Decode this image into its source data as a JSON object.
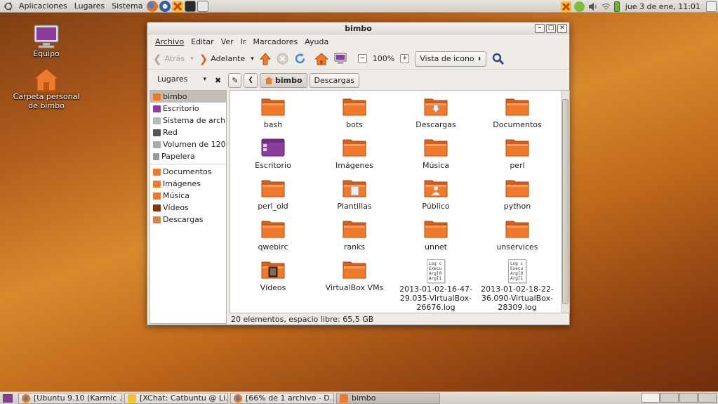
{
  "top_panel": {
    "menus": [
      "Aplicaciones",
      "Lugares",
      "Sistema"
    ],
    "clock": "jue  3 de ene, 11:01"
  },
  "desktop": {
    "icons": [
      {
        "label": "Equipo"
      },
      {
        "label": "Carpeta personal de bimbo"
      }
    ]
  },
  "window": {
    "title": "bimbo",
    "menu": [
      "Archivo",
      "Editar",
      "Ver",
      "Ir",
      "Marcadores",
      "Ayuda"
    ],
    "toolbar": {
      "back": "Atrás",
      "forward": "Adelante",
      "zoom": "100%",
      "view": "Vista de icono"
    },
    "places_label": "Lugares",
    "breadcrumbs": [
      "bimbo",
      "Descargas"
    ],
    "sidebar": {
      "places": [
        "bimbo",
        "Escritorio",
        "Sistema de arch...",
        "Red",
        "Volumen de 120...",
        "Papelera"
      ],
      "bookmarks": [
        "Documentos",
        "Imágenes",
        "Música",
        "Vídeos",
        "Descargas"
      ]
    },
    "files": [
      {
        "name": "bash",
        "kind": "folder"
      },
      {
        "name": "bots",
        "kind": "folder"
      },
      {
        "name": "Descargas",
        "kind": "downloads-folder"
      },
      {
        "name": "Documentos",
        "kind": "folder"
      },
      {
        "name": "Escritorio",
        "kind": "desktop-folder"
      },
      {
        "name": "Imágenes",
        "kind": "folder"
      },
      {
        "name": "Música",
        "kind": "folder"
      },
      {
        "name": "perl",
        "kind": "folder"
      },
      {
        "name": "perl_old",
        "kind": "folder"
      },
      {
        "name": "Plantillas",
        "kind": "templates-folder"
      },
      {
        "name": "Público",
        "kind": "public-folder"
      },
      {
        "name": "python",
        "kind": "folder"
      },
      {
        "name": "qwebirc",
        "kind": "folder"
      },
      {
        "name": "ranks",
        "kind": "folder"
      },
      {
        "name": "unnet",
        "kind": "folder"
      },
      {
        "name": "unservices",
        "kind": "folder"
      },
      {
        "name": "Vídeos",
        "kind": "videos-folder"
      },
      {
        "name": "VirtualBox VMs",
        "kind": "folder"
      },
      {
        "name": "2013-01-02-16-47-29.035-VirtualBox-26676.log",
        "kind": "log"
      },
      {
        "name": "2013-01-02-18-22-36.090-VirtualBox-28309.log",
        "kind": "log"
      }
    ],
    "log_preview": "Log c\nExecu\nArg[0\nArg[1",
    "status": "20 elementos, espacio libre: 65,5 GB"
  },
  "taskbar": {
    "tasks": [
      "[Ubuntu 9.10 (Karmic ...",
      "[XChat: Catbuntu @ Li...",
      "[66% de 1 archivo - D...",
      "bimbo"
    ]
  },
  "colors": {
    "folder_orange": "#f07a2c",
    "selection": "#c4bdb5",
    "panel": "#dcd8d2"
  }
}
